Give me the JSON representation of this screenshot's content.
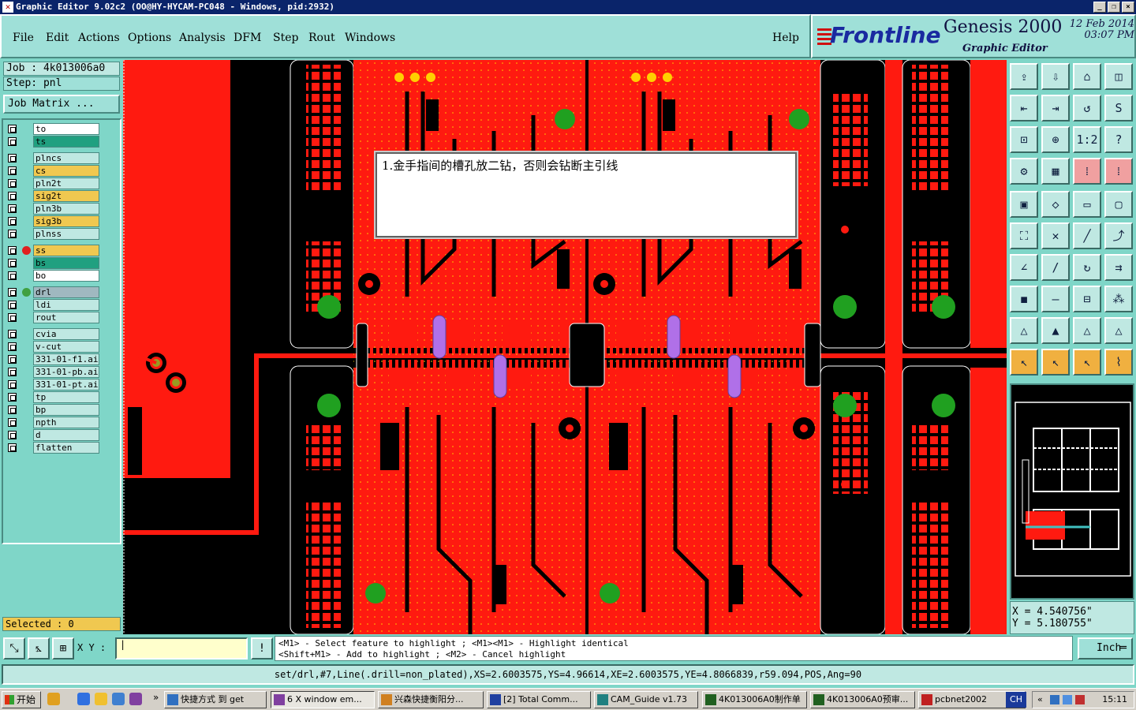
{
  "window": {
    "title": "Graphic Editor 9.02c2 (OO@HY-HYCAM-PC048 - Windows, pid:2932)",
    "buttons": [
      "_",
      "❐",
      "×"
    ]
  },
  "menu": [
    "File",
    "Edit",
    "Actions",
    "Options",
    "Analysis",
    "DFM",
    "Step",
    "Rout",
    "Windows"
  ],
  "help_label": "Help",
  "brand": {
    "logo": "Frontline",
    "product": "Genesis 2000",
    "date": "12 Feb 2014",
    "time": "03:07 PM",
    "subtitle": "Graphic Editor"
  },
  "job": {
    "job_label": "Job : 4k013006a0",
    "step_label": "Step: pnl",
    "matrix_button": "Job Matrix ..."
  },
  "layers": [
    {
      "name": "to",
      "bg": "#ffffff",
      "dot": ""
    },
    {
      "name": "ts",
      "bg": "#20a080",
      "dot": ""
    },
    {
      "name": "plncs",
      "bg": "#bfe8e2",
      "dot": ""
    },
    {
      "name": "cs",
      "bg": "#f0c850",
      "dot": ""
    },
    {
      "name": "pln2t",
      "bg": "#bfe8e2",
      "dot": ""
    },
    {
      "name": "sig2t",
      "bg": "#f0c850",
      "dot": ""
    },
    {
      "name": "pln3b",
      "bg": "#bfe8e2",
      "dot": ""
    },
    {
      "name": "sig3b",
      "bg": "#f0c850",
      "dot": ""
    },
    {
      "name": "plnss",
      "bg": "#bfe8e2",
      "dot": ""
    },
    {
      "name": "ss",
      "bg": "#f0c850",
      "dot": "#e02020"
    },
    {
      "name": "bs",
      "bg": "#20a080",
      "dot": ""
    },
    {
      "name": "bo",
      "bg": "#ffffff",
      "dot": ""
    },
    {
      "name": "drl",
      "bg": "#a0b8c0",
      "dot": "#40a040"
    },
    {
      "name": "ldi",
      "bg": "#bfe8e2",
      "dot": ""
    },
    {
      "name": "rout",
      "bg": "#bfe8e2",
      "dot": ""
    },
    {
      "name": "cvia",
      "bg": "#bfe8e2",
      "dot": ""
    },
    {
      "name": "v-cut",
      "bg": "#bfe8e2",
      "dot": ""
    },
    {
      "name": "331-01-f1.ai",
      "bg": "#bfe8e2",
      "dot": ""
    },
    {
      "name": "331-01-pb.ai",
      "bg": "#bfe8e2",
      "dot": ""
    },
    {
      "name": "331-01-pt.ai",
      "bg": "#bfe8e2",
      "dot": ""
    },
    {
      "name": "tp",
      "bg": "#bfe8e2",
      "dot": ""
    },
    {
      "name": "bp",
      "bg": "#bfe8e2",
      "dot": ""
    },
    {
      "name": "npth",
      "bg": "#bfe8e2",
      "dot": ""
    },
    {
      "name": "d",
      "bg": "#bfe8e2",
      "dot": ""
    },
    {
      "name": "flatten",
      "bg": "#bfe8e2",
      "dot": ""
    }
  ],
  "selected_label": "Selected : 0",
  "comment": "1.金手指间的槽孔放二钻，否则会钻断主引线",
  "coords": {
    "x": "X = 4.540756\"",
    "y": "Y = 5.180755\""
  },
  "xy_label": "X Y :",
  "help_lines": [
    "<M1> - Select feature to highlight ; <M1><M1> - Highlight identical",
    "<Shift+M1> - Add to highlight ; <M2> - Cancel highlight"
  ],
  "unit_button": "Inch",
  "status": "set/drl,#7,Line(.drill=non_plated),XS=2.6003575,YS=4.96614,XE=2.6003575,YE=4.8066839,r59.094,POS,Ang=90",
  "taskbar": {
    "start": "开始",
    "tasks": [
      {
        "label": "快捷方式 到 get",
        "color": "#3070c0"
      },
      {
        "label": "6 X window em...",
        "color": "#8040a0"
      },
      {
        "label": "兴森快捷衡阳分...",
        "color": "#d08020"
      },
      {
        "label": "[2] Total Comm...",
        "color": "#2040a0"
      },
      {
        "label": "CAM_Guide v1.73",
        "color": "#208080"
      },
      {
        "label": "4K013006A0制作单",
        "color": "#206020"
      },
      {
        "label": "4K013006A0预审...",
        "color": "#206020"
      },
      {
        "label": "pcbnet2002",
        "color": "#c02020"
      }
    ],
    "lang": "CH",
    "clock": "15:11"
  },
  "colors": {
    "board_red": "#ff1a10",
    "slot": "#b070e8",
    "pad_green": "#20a020"
  }
}
